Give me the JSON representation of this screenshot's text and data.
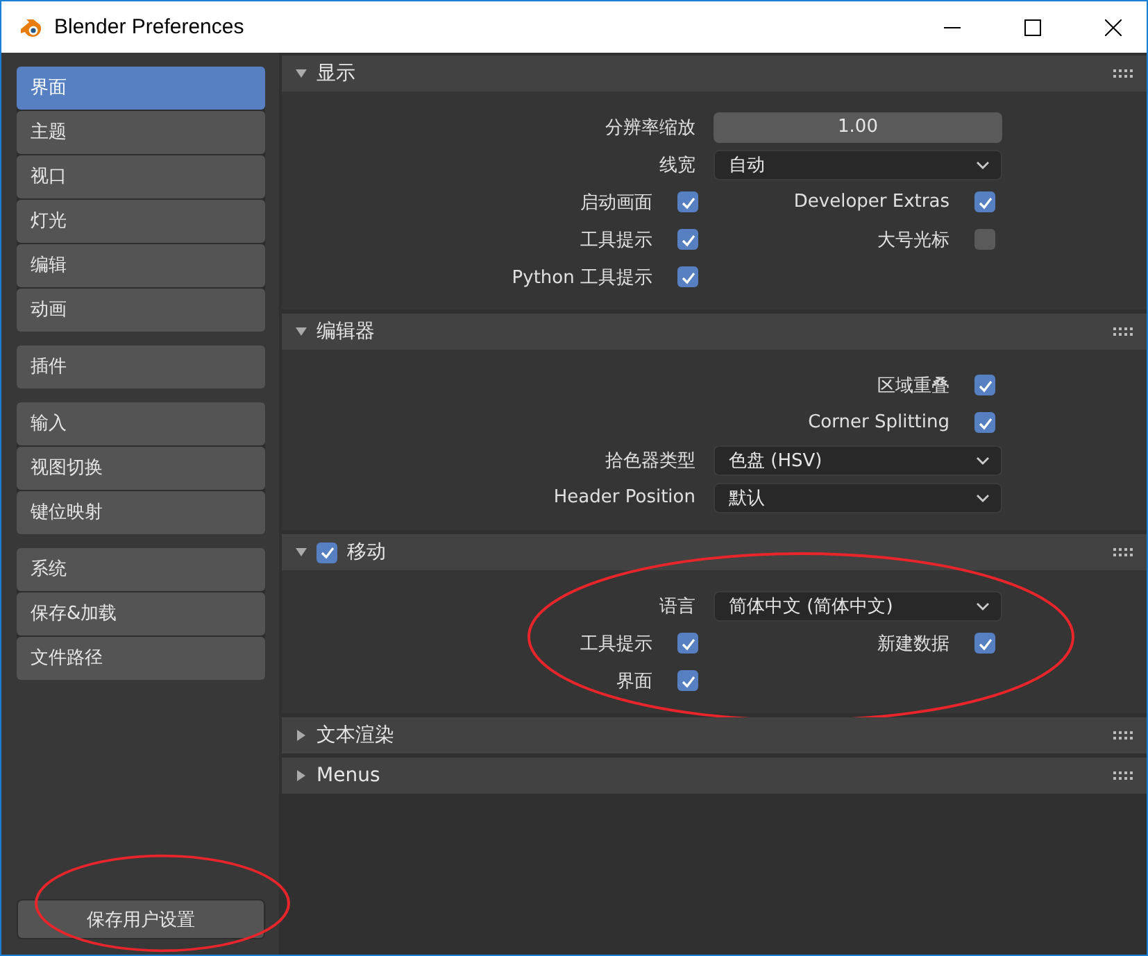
{
  "window": {
    "title": "Blender Preferences"
  },
  "sidebar": {
    "groups": [
      {
        "items": [
          {
            "label": "界面",
            "selected": true
          },
          {
            "label": "主题",
            "selected": false
          },
          {
            "label": "视口",
            "selected": false
          },
          {
            "label": "灯光",
            "selected": false
          },
          {
            "label": "编辑",
            "selected": false
          },
          {
            "label": "动画",
            "selected": false
          }
        ]
      },
      {
        "items": [
          {
            "label": "插件",
            "selected": false
          }
        ]
      },
      {
        "items": [
          {
            "label": "输入",
            "selected": false
          },
          {
            "label": "视图切换",
            "selected": false
          },
          {
            "label": "键位映射",
            "selected": false
          }
        ]
      },
      {
        "items": [
          {
            "label": "系统",
            "selected": false
          },
          {
            "label": "保存&加载",
            "selected": false
          },
          {
            "label": "文件路径",
            "selected": false
          }
        ]
      }
    ],
    "save_button": {
      "label": "保存用户设置",
      "circled": true
    }
  },
  "sections": [
    {
      "title": "显示",
      "expanded": true,
      "rows": [
        {
          "kind": "number",
          "label": "分辨率缩放",
          "value": "1.00"
        },
        {
          "kind": "dropdown",
          "label": "线宽",
          "value": "自动"
        },
        {
          "kind": "checks",
          "left": {
            "label": "启动画面",
            "checked": true
          },
          "right": {
            "label": "Developer Extras",
            "checked": true
          }
        },
        {
          "kind": "checks",
          "left": {
            "label": "工具提示",
            "checked": true
          },
          "right": {
            "label": "大号光标",
            "checked": false
          }
        },
        {
          "kind": "checks",
          "left": {
            "label": "Python 工具提示",
            "checked": true
          }
        }
      ]
    },
    {
      "title": "编辑器",
      "expanded": true,
      "rows": [
        {
          "kind": "checks",
          "right": {
            "label": "区域重叠",
            "checked": true
          }
        },
        {
          "kind": "checks",
          "right": {
            "label": "Corner Splitting",
            "checked": true
          }
        },
        {
          "kind": "dropdown",
          "label": "拾色器类型",
          "value": "色盘 (HSV)"
        },
        {
          "kind": "dropdown",
          "label": "Header Position",
          "value": "默认"
        }
      ]
    },
    {
      "title": "移动",
      "expanded": true,
      "checked": true,
      "circled": true,
      "rows": [
        {
          "kind": "dropdown",
          "label": "语言",
          "value": "简体中文 (简体中文)"
        },
        {
          "kind": "checks",
          "left": {
            "label": "工具提示",
            "checked": true
          },
          "right": {
            "label": "新建数据",
            "checked": true
          }
        },
        {
          "kind": "checks",
          "left": {
            "label": "界面",
            "checked": true
          }
        }
      ]
    },
    {
      "title": "文本渲染",
      "expanded": false
    },
    {
      "title": "Menus",
      "expanded": false
    }
  ]
}
